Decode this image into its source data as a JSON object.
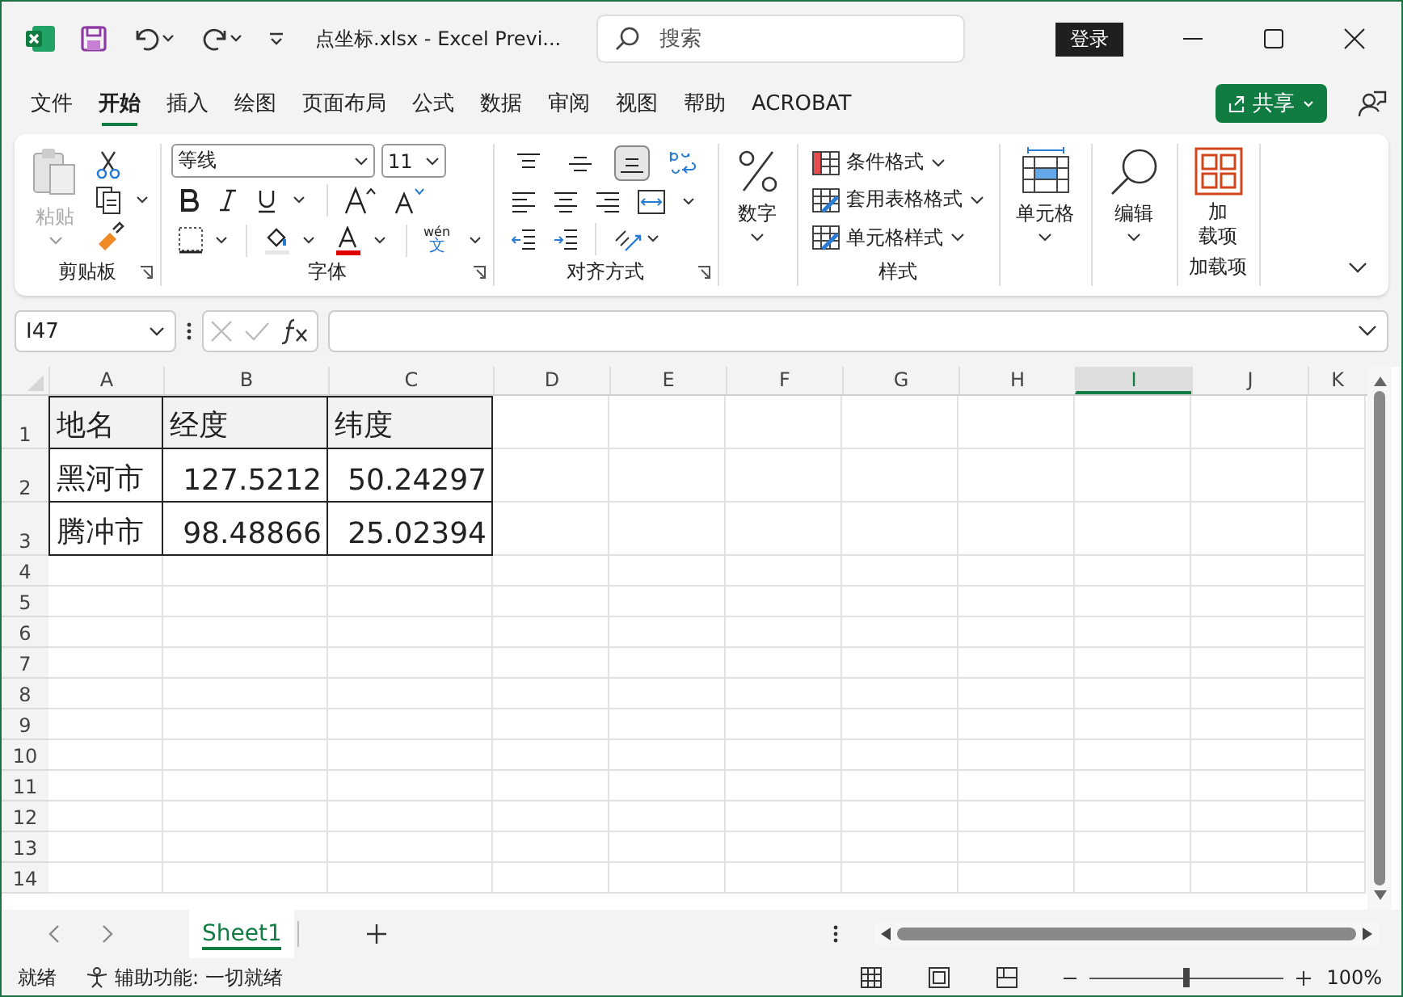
{
  "title_bar": {
    "document_title": "点坐标.xlsx  -  Excel Previ...",
    "search_placeholder": "搜索",
    "login_button": "登录"
  },
  "menu_tabs": [
    {
      "label": "文件",
      "selected": false
    },
    {
      "label": "开始",
      "selected": true
    },
    {
      "label": "插入",
      "selected": false
    },
    {
      "label": "绘图",
      "selected": false
    },
    {
      "label": "页面布局",
      "selected": false
    },
    {
      "label": "公式",
      "selected": false
    },
    {
      "label": "数据",
      "selected": false
    },
    {
      "label": "审阅",
      "selected": false
    },
    {
      "label": "视图",
      "selected": false
    },
    {
      "label": "帮助",
      "selected": false
    },
    {
      "label": "ACROBAT",
      "selected": false
    }
  ],
  "share_button": "共享",
  "ribbon": {
    "clipboard": {
      "paste": {
        "label": "粘贴",
        "disabled": true
      },
      "group_label": "剪贴板"
    },
    "font": {
      "font_name": "等线",
      "font_size": "11",
      "phonetic_top": "wén",
      "phonetic_bottom": "文",
      "group_label": "字体"
    },
    "alignment": {
      "vertical_align": [
        {
          "kind": "top",
          "selected": false
        },
        {
          "kind": "middle",
          "selected": false
        },
        {
          "kind": "bottom",
          "selected": true
        }
      ],
      "group_label": "对齐方式"
    },
    "number": {
      "label": "数字"
    },
    "styles": {
      "items": [
        "条件格式",
        "套用表格格式",
        "单元格样式"
      ],
      "group_label": "样式"
    },
    "cells": {
      "label": "单元格"
    },
    "editing": {
      "label": "编辑"
    },
    "addins": {
      "label_lines": [
        "加",
        "载项"
      ],
      "group_label": "加载项"
    }
  },
  "formula_bar": {
    "name_box": "I47"
  },
  "sheet": {
    "columns": [
      {
        "label": "A",
        "selected": false
      },
      {
        "label": "B",
        "selected": false
      },
      {
        "label": "C",
        "selected": false
      },
      {
        "label": "D",
        "selected": false
      },
      {
        "label": "E",
        "selected": false
      },
      {
        "label": "F",
        "selected": false
      },
      {
        "label": "G",
        "selected": false
      },
      {
        "label": "H",
        "selected": false
      },
      {
        "label": "I",
        "selected": true
      },
      {
        "label": "J",
        "selected": false
      },
      {
        "label": "K",
        "selected": false
      }
    ],
    "rows": [
      {
        "label": "1",
        "cells": [
          {
            "text": "地名",
            "kind": "header"
          },
          {
            "text": "经度",
            "kind": "header"
          },
          {
            "text": "纬度",
            "kind": "header"
          }
        ]
      },
      {
        "label": "2",
        "cells": [
          {
            "text": "黑河市",
            "kind": "text"
          },
          {
            "text": "127.5212",
            "kind": "number"
          },
          {
            "text": "50.24297",
            "kind": "number"
          }
        ]
      },
      {
        "label": "3",
        "cells": [
          {
            "text": "腾冲市",
            "kind": "text"
          },
          {
            "text": "98.48866",
            "kind": "number"
          },
          {
            "text": "25.02394",
            "kind": "number"
          }
        ]
      },
      {
        "label": "4"
      },
      {
        "label": "5"
      },
      {
        "label": "6"
      },
      {
        "label": "7"
      },
      {
        "label": "8"
      },
      {
        "label": "9"
      },
      {
        "label": "10"
      },
      {
        "label": "11"
      },
      {
        "label": "12"
      },
      {
        "label": "13"
      },
      {
        "label": "14"
      }
    ]
  },
  "sheet_tabs": [
    {
      "label": "Sheet1",
      "selected": true
    }
  ],
  "status_bar": {
    "status": "就绪",
    "accessibility": "辅助功能: 一切就绪",
    "zoom": "100%",
    "zoom_slider": {
      "level": 0.5
    }
  }
}
